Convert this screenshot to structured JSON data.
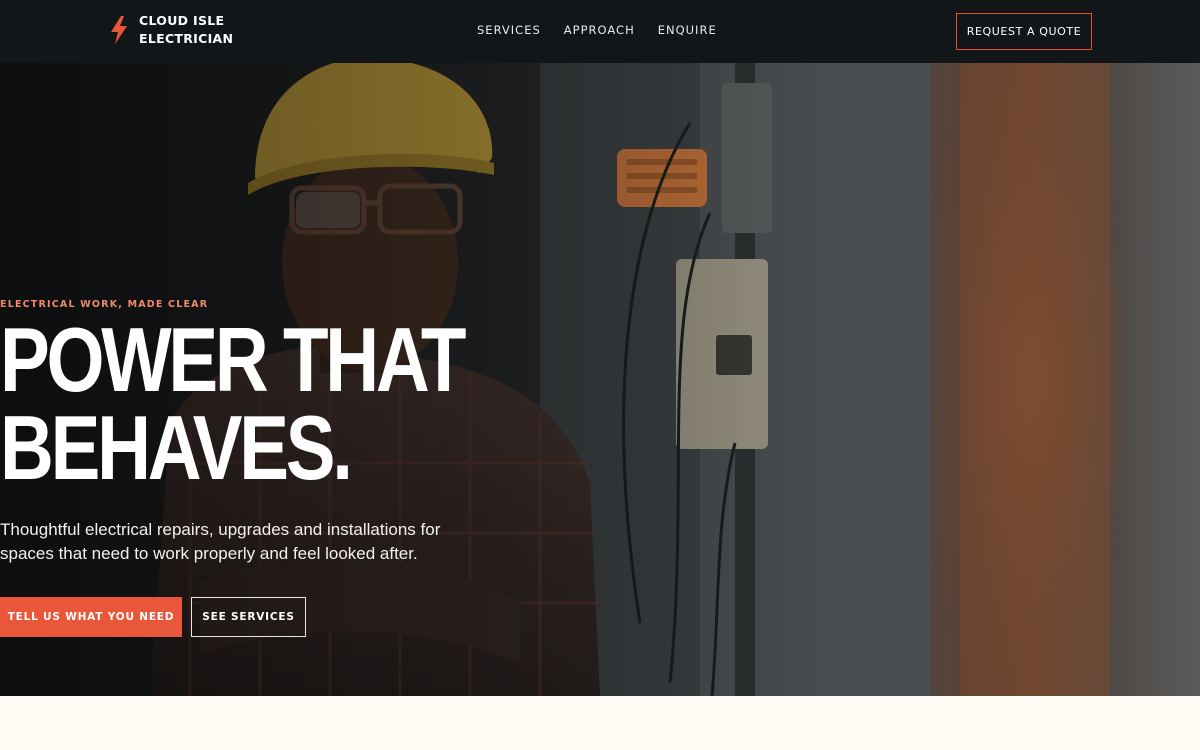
{
  "brand": {
    "name_line1": "CLOUD ISLE",
    "name_line2": "ELECTRICIAN",
    "icon": "lightning-bolt-icon",
    "accent_color": "#e9573a"
  },
  "nav": {
    "items": [
      {
        "label": "SERVICES"
      },
      {
        "label": "APPROACH"
      },
      {
        "label": "ENQUIRE"
      }
    ],
    "cta_label": "REQUEST A QUOTE"
  },
  "hero": {
    "eyebrow": "ELECTRICAL WORK, MADE CLEAR",
    "headline_line1": "POWER THAT",
    "headline_line2": "BEHAVES.",
    "subcopy": "Thoughtful electrical repairs, upgrades and installations for spaces that need to work properly and feel looked after.",
    "primary_button": "TELL US WHAT YOU NEED",
    "secondary_button": "SEE SERVICES",
    "image": "electrician-in-hard-hat-photo"
  },
  "colors": {
    "header_bg": "#121619",
    "page_bg": "#fdfbf4",
    "eyebrow": "#f08a6e"
  }
}
